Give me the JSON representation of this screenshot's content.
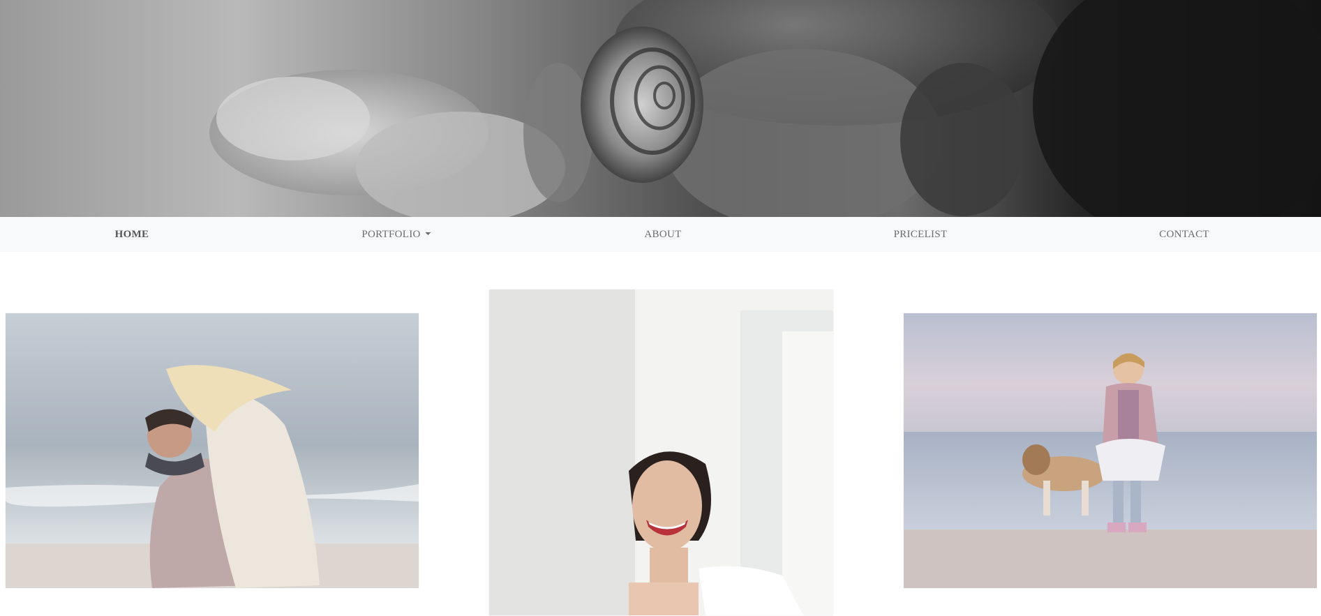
{
  "hero": {
    "image": "snail-on-flower-black-and-white"
  },
  "nav": {
    "items": [
      {
        "label": "HOME",
        "active": true
      },
      {
        "label": "PORTFOLIO",
        "dropdown": true
      },
      {
        "label": "ABOUT"
      },
      {
        "label": "PRICELIST"
      },
      {
        "label": "CONTACT"
      }
    ]
  },
  "gallery": {
    "photos": [
      {
        "subject": "couple-embracing-on-beach"
      },
      {
        "subject": "smiling-bride-behind-door"
      },
      {
        "subject": "girl-with-beagle-by-sea"
      }
    ]
  },
  "colors": {
    "navbar_bg": "#f8f9fa",
    "nav_text": "#6b6b6b",
    "page_bg": "#ffffff"
  }
}
